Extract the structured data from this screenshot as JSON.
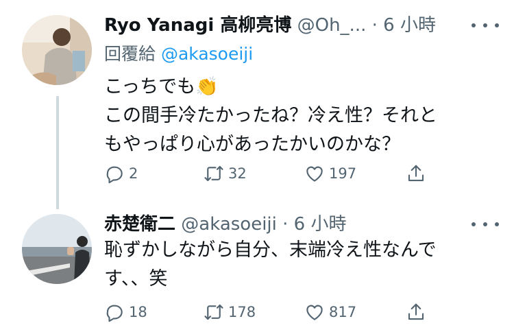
{
  "tweets": [
    {
      "display_name": "Ryo Yanagi 高柳亮博",
      "handle": "@Oh_...",
      "time": "· 6 小時",
      "replying_label": "回覆給",
      "replying_handle": "@akasoeiji",
      "text_line1": "こっちでも",
      "text_emoji": "👏",
      "text_line2": "この間手冷たかったね？冷え性？それと",
      "text_line3": "もやっぱり心があったかいのかな？",
      "replies": "2",
      "retweets": "32",
      "likes": "197"
    },
    {
      "display_name": "赤楚衛二",
      "handle": "@akasoeiji",
      "time": "· 6 小時",
      "text_line1": "恥ずかしながら自分、末端冷え性なんで",
      "text_line2": "す、、笑",
      "replies": "18",
      "retweets": "178",
      "likes": "817"
    }
  ],
  "icons": {
    "reply": "reply-icon",
    "retweet": "retweet-icon",
    "like": "heart-icon",
    "share": "share-icon",
    "more": "more-icon"
  }
}
